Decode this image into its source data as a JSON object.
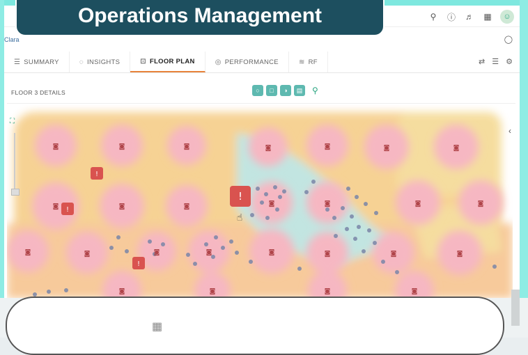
{
  "banner": {
    "title": "Operations Management"
  },
  "topbar": {
    "icons": [
      "search-icon",
      "help-icon",
      "bell-icon",
      "apps-icon"
    ],
    "avatar_glyph": "☺"
  },
  "breadcrumb": {
    "text": "Clara"
  },
  "tabs": [
    {
      "label": "SUMMARY",
      "icon": "☰"
    },
    {
      "label": "INSIGHTS",
      "icon": "◌"
    },
    {
      "label": "FLOOR PLAN",
      "icon": "⊡"
    },
    {
      "label": "PERFORMANCE",
      "icon": "◎"
    },
    {
      "label": "RF",
      "icon": "≋"
    }
  ],
  "details": {
    "title": "FLOOR 3 DETAILS"
  },
  "map": {
    "accent": "#d9534f",
    "heat_colors": {
      "pink": "#f6b7c2",
      "orange": "#f8c89a",
      "yellow": "#f5dc9a",
      "teal": "#bfe4e0"
    },
    "alerts_count": 4
  }
}
